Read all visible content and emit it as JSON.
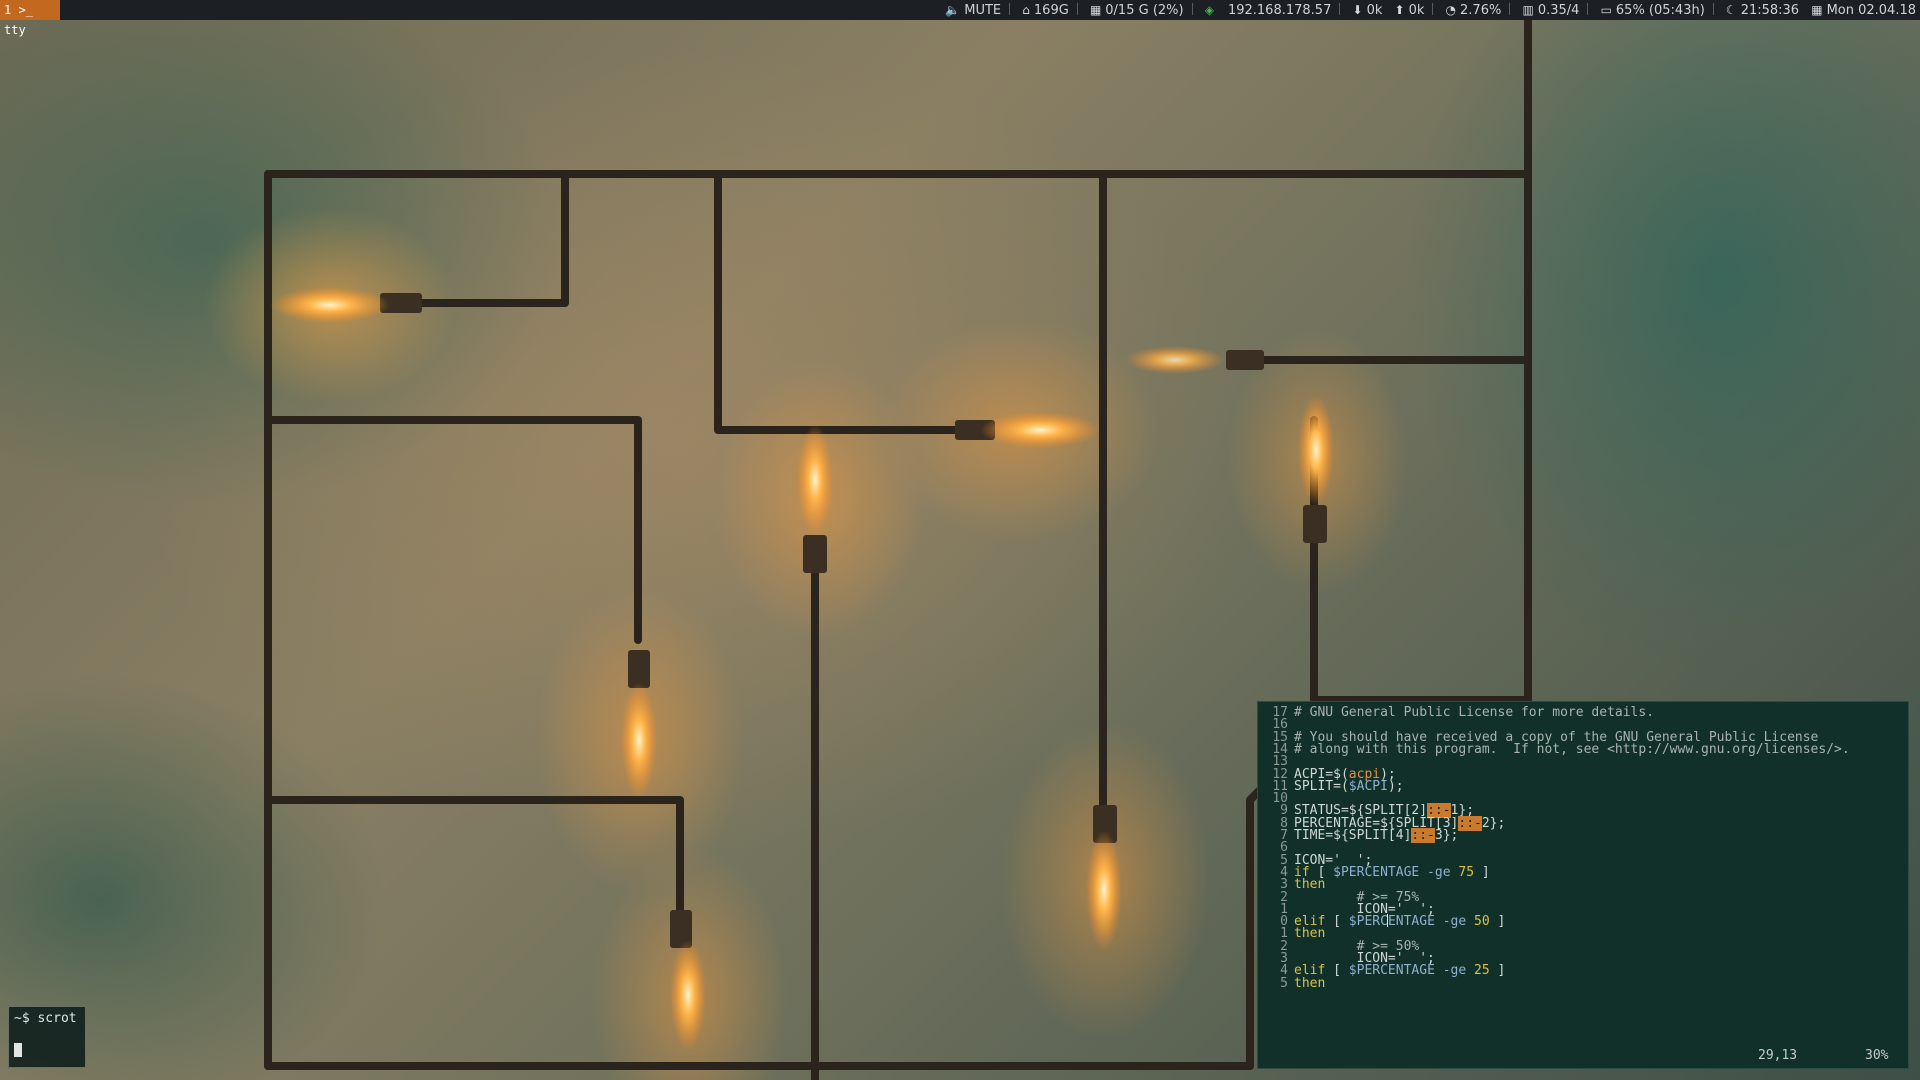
{
  "topbar": {
    "workspace": "1 >_ tty",
    "volume": "MUTE",
    "home": "169G",
    "storage": "0/15 G (2%)",
    "ip": "192.168.178.57",
    "download": "0k",
    "upload": "0k",
    "cpu": "2.76%",
    "load": "0.35/4",
    "battery": "65% (05:43h)",
    "time": "21:58:36",
    "date": "Mon 02.04.18",
    "accent_color": "#c2691f",
    "wifi_color": "#3fbf4f"
  },
  "small_terminal": {
    "prompt_line": "~$ scrot"
  },
  "editor": {
    "lines": [
      {
        "num": "17",
        "parts": [
          {
            "t": "# GNU General Public License for more details.",
            "c": "cm"
          }
        ]
      },
      {
        "num": "16",
        "parts": []
      },
      {
        "num": "15",
        "parts": [
          {
            "t": "# You should have received a copy of the GNU General Public License",
            "c": "cm"
          }
        ]
      },
      {
        "num": "14",
        "parts": [
          {
            "t": "# along with this program.  If not, see <http://www.gnu.org/licenses/>.",
            "c": "cm"
          }
        ]
      },
      {
        "num": "13",
        "parts": []
      },
      {
        "num": "12",
        "parts": [
          {
            "t": "ACPI=$(",
            "c": ""
          },
          {
            "t": "acpi",
            "c": "fn"
          },
          {
            "t": ");",
            "c": ""
          }
        ]
      },
      {
        "num": "11",
        "parts": [
          {
            "t": "SPLIT=(",
            "c": ""
          },
          {
            "t": "$ACPI",
            "c": "var"
          },
          {
            "t": ");",
            "c": ""
          }
        ]
      },
      {
        "num": "10",
        "parts": []
      },
      {
        "num": "9",
        "parts": [
          {
            "t": "STATUS=${SPLIT[2]",
            "c": ""
          },
          {
            "t": "::-",
            "c": "hl"
          },
          {
            "t": "1};",
            "c": ""
          }
        ]
      },
      {
        "num": "8",
        "parts": [
          {
            "t": "PERCENTAGE=${SPLIT[3]",
            "c": ""
          },
          {
            "t": "::-",
            "c": "hl"
          },
          {
            "t": "2};",
            "c": ""
          }
        ]
      },
      {
        "num": "7",
        "parts": [
          {
            "t": "TIME=${SPLIT[4]",
            "c": ""
          },
          {
            "t": "::-",
            "c": "hl"
          },
          {
            "t": "3};",
            "c": ""
          }
        ]
      },
      {
        "num": "6",
        "parts": []
      },
      {
        "num": "5",
        "parts": [
          {
            "t": "ICON='  ';",
            "c": ""
          }
        ]
      },
      {
        "num": "4",
        "parts": [
          {
            "t": "if",
            "c": "kw"
          },
          {
            "t": " [ ",
            "c": ""
          },
          {
            "t": "$PERCENTAGE",
            "c": "var"
          },
          {
            "t": " -ge ",
            "c": "var"
          },
          {
            "t": "75",
            "c": "num"
          },
          {
            "t": " ]",
            "c": ""
          }
        ]
      },
      {
        "num": "3",
        "parts": [
          {
            "t": "then",
            "c": "kw"
          }
        ]
      },
      {
        "num": "2",
        "parts": [
          {
            "t": "        # >= 75%",
            "c": "cm"
          }
        ]
      },
      {
        "num": "1",
        "parts": [
          {
            "t": "        ICON='  ';",
            "c": ""
          }
        ]
      },
      {
        "num": "0",
        "parts": [
          {
            "t": "elif",
            "c": "kw"
          },
          {
            "t": " [ ",
            "c": ""
          },
          {
            "t": "$PERC",
            "c": "var"
          },
          {
            "t": "|",
            "c": "cursor"
          },
          {
            "t": "ENTAGE",
            "c": "var"
          },
          {
            "t": " -ge ",
            "c": "var"
          },
          {
            "t": "50",
            "c": "num"
          },
          {
            "t": " ]",
            "c": ""
          }
        ]
      },
      {
        "num": "1",
        "parts": [
          {
            "t": "then",
            "c": "kw"
          }
        ]
      },
      {
        "num": "2",
        "parts": [
          {
            "t": "        # >= 50%",
            "c": "cm"
          }
        ]
      },
      {
        "num": "3",
        "parts": [
          {
            "t": "        ICON='  ';",
            "c": ""
          }
        ]
      },
      {
        "num": "4",
        "parts": [
          {
            "t": "elif",
            "c": "kw"
          },
          {
            "t": " [ ",
            "c": ""
          },
          {
            "t": "$PERCENTAGE",
            "c": "var"
          },
          {
            "t": " -ge ",
            "c": "var"
          },
          {
            "t": "25",
            "c": "num"
          },
          {
            "t": " ]",
            "c": ""
          }
        ]
      },
      {
        "num": "5",
        "parts": [
          {
            "t": "then",
            "c": "kw"
          }
        ]
      }
    ],
    "cursor_pos": "29,13",
    "scroll_pct": "30%"
  }
}
